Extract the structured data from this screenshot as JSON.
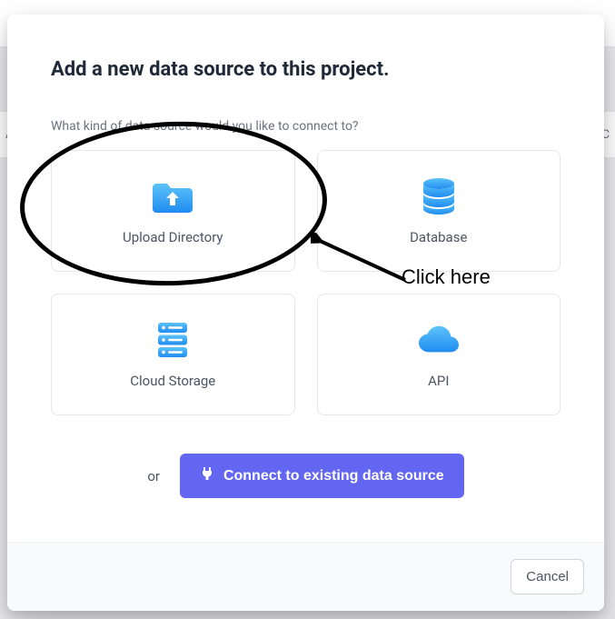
{
  "background": {
    "row1_left": "",
    "row2_left": "AD",
    "row2_right": "SC"
  },
  "modal": {
    "title": "Add a new data source to this project.",
    "subtitle": "What kind of data source would you like to connect to?",
    "cards": [
      {
        "label": "Upload Directory"
      },
      {
        "label": "Database"
      },
      {
        "label": "Cloud Storage"
      },
      {
        "label": "API"
      }
    ],
    "or_text": "or",
    "connect_button": "Connect to existing data source",
    "cancel_button": "Cancel"
  },
  "annotation": {
    "click_here": "Click here"
  }
}
